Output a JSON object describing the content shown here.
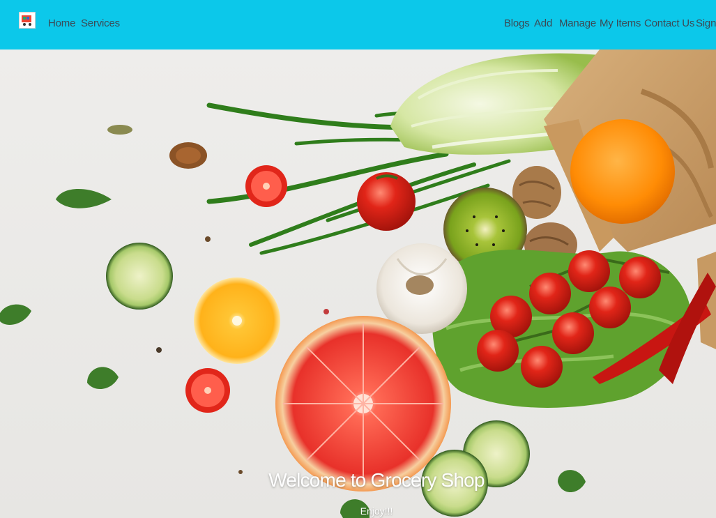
{
  "navbar": {
    "logo_icon": "grocery-cart-logo-icon",
    "background_color": "#0cc8ea",
    "links_left": [
      "Home",
      "Services"
    ],
    "links_right": [
      "Blogs",
      "Add",
      "Manage",
      "My Items",
      "Contact Us",
      "Sign"
    ]
  },
  "hero": {
    "title": "Welcome to Grocery Shop",
    "subtitle": "Enjoy!!!",
    "image_icon": "fresh-vegetables-grocery-bag-photo"
  }
}
